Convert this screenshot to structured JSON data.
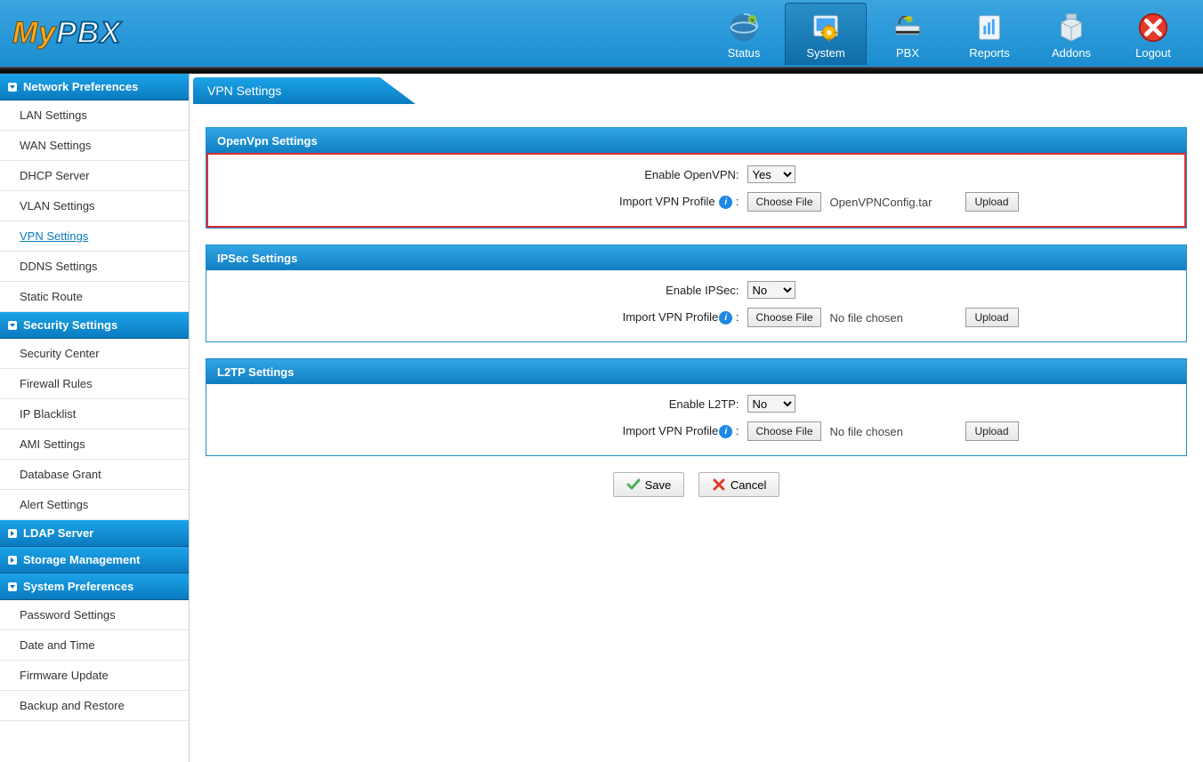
{
  "header": {
    "logo_my": "My",
    "logo_pbx": "PBX",
    "nav": [
      {
        "label": "Status"
      },
      {
        "label": "System"
      },
      {
        "label": "PBX"
      },
      {
        "label": "Reports"
      },
      {
        "label": "Addons"
      },
      {
        "label": "Logout"
      }
    ]
  },
  "sidebar": {
    "sections": [
      {
        "title": "Network Preferences",
        "items": [
          {
            "label": "LAN Settings"
          },
          {
            "label": "WAN Settings"
          },
          {
            "label": "DHCP Server"
          },
          {
            "label": "VLAN Settings"
          },
          {
            "label": "VPN Settings",
            "active": true
          },
          {
            "label": "DDNS Settings"
          },
          {
            "label": "Static Route"
          }
        ]
      },
      {
        "title": "Security Settings",
        "items": [
          {
            "label": "Security Center"
          },
          {
            "label": "Firewall Rules"
          },
          {
            "label": "IP Blacklist"
          },
          {
            "label": "AMI Settings"
          },
          {
            "label": "Database Grant"
          },
          {
            "label": "Alert Settings"
          }
        ]
      },
      {
        "title": "LDAP Server",
        "items": []
      },
      {
        "title": "Storage Management",
        "items": []
      },
      {
        "title": "System Preferences",
        "items": [
          {
            "label": "Password Settings"
          },
          {
            "label": "Date and Time"
          },
          {
            "label": "Firmware Update"
          },
          {
            "label": "Backup and Restore"
          }
        ]
      }
    ]
  },
  "page": {
    "title": "VPN Settings",
    "panels": {
      "openvpn": {
        "title": "OpenVpn Settings",
        "enable_label": "Enable OpenVPN:",
        "enable_value": "Yes",
        "import_label": "Import VPN Profile",
        "file_button": "Choose File",
        "file_name": "OpenVPNConfig.tar",
        "upload": "Upload"
      },
      "ipsec": {
        "title": "IPSec Settings",
        "enable_label": "Enable IPSec:",
        "enable_value": "No",
        "import_label": "Import VPN Profile",
        "file_button": "Choose File",
        "file_name": "No file chosen",
        "upload": "Upload"
      },
      "l2tp": {
        "title": "L2TP Settings",
        "enable_label": "Enable L2TP:",
        "enable_value": "No",
        "import_label": "Import VPN Profile",
        "file_button": "Choose File",
        "file_name": "No file chosen",
        "upload": "Upload"
      }
    },
    "actions": {
      "save": "Save",
      "cancel": "Cancel"
    }
  }
}
